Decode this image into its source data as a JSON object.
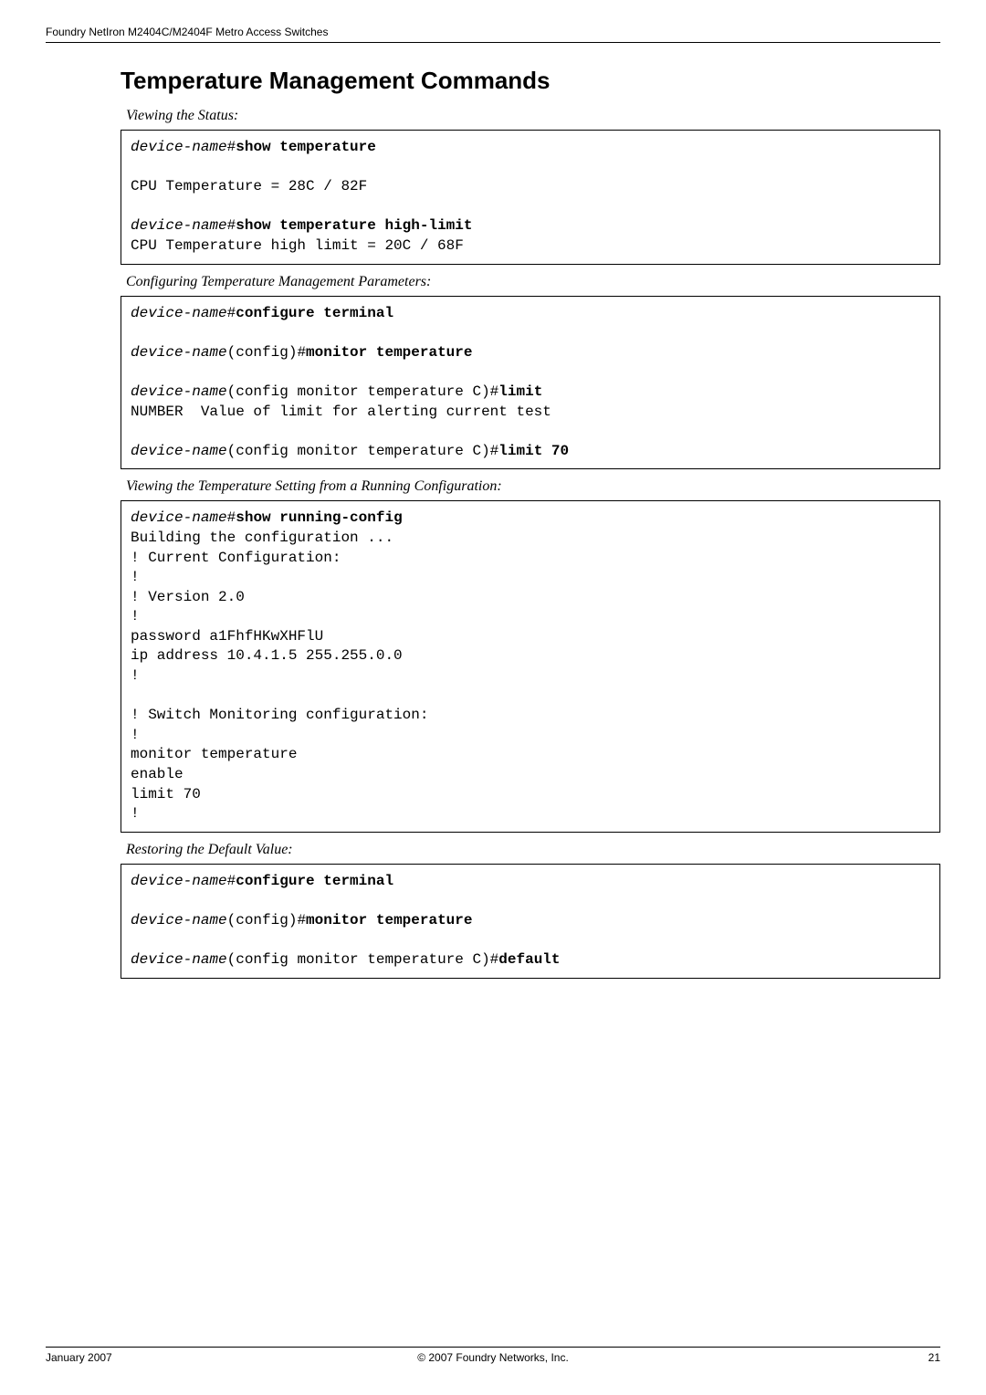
{
  "header": {
    "text": "Foundry NetIron M2404C/M2404F Metro Access Switches"
  },
  "title": "Temperature Management Commands",
  "captions": {
    "c1": "Viewing the Status:",
    "c2": " Configuring Temperature   Management Parameters:",
    "c3": "Viewing the Temperature Setting from a Running Configuration:",
    "c4": "Restoring the Default Value:"
  },
  "code1": {
    "dn": "device-name",
    "hash": "#",
    "cmd1": "show temperature",
    "out1": "CPU Temperature = 28C / 82F",
    "cmd2": "show temperature high-limit",
    "out2": "CPU Temperature high limit = 20C / 68F"
  },
  "code2": {
    "dn": "device-name",
    "hash": "#",
    "cmd1": "configure terminal",
    "ctx2": "(config)#",
    "cmd2": "monitor temperature",
    "ctx3": "(config monitor temperature C)#",
    "cmd3": "limit",
    "out3": "NUMBER  Value of limit for alerting current test",
    "cmd4": "limit 70"
  },
  "code3": {
    "dn": "device-name",
    "hash": "#",
    "cmd1": "show running-config",
    "body": "Building the configuration ...\n! Current Configuration:\n!\n! Version 2.0\n!\npassword a1FhfHKwXHFlU\nip address 10.4.1.5 255.255.0.0\n!\n\n! Switch Monitoring configuration:\n!\nmonitor temperature\nenable\nlimit 70\n!"
  },
  "code4": {
    "dn": "device-name",
    "hash": "#",
    "cmd1": "configure terminal",
    "ctx2": "(config)#",
    "cmd2": "monitor temperature",
    "ctx3": "(config monitor temperature C)#",
    "cmd3": "default"
  },
  "footer": {
    "left": "January 2007",
    "center": "© 2007 Foundry Networks, Inc.",
    "right": "21"
  }
}
